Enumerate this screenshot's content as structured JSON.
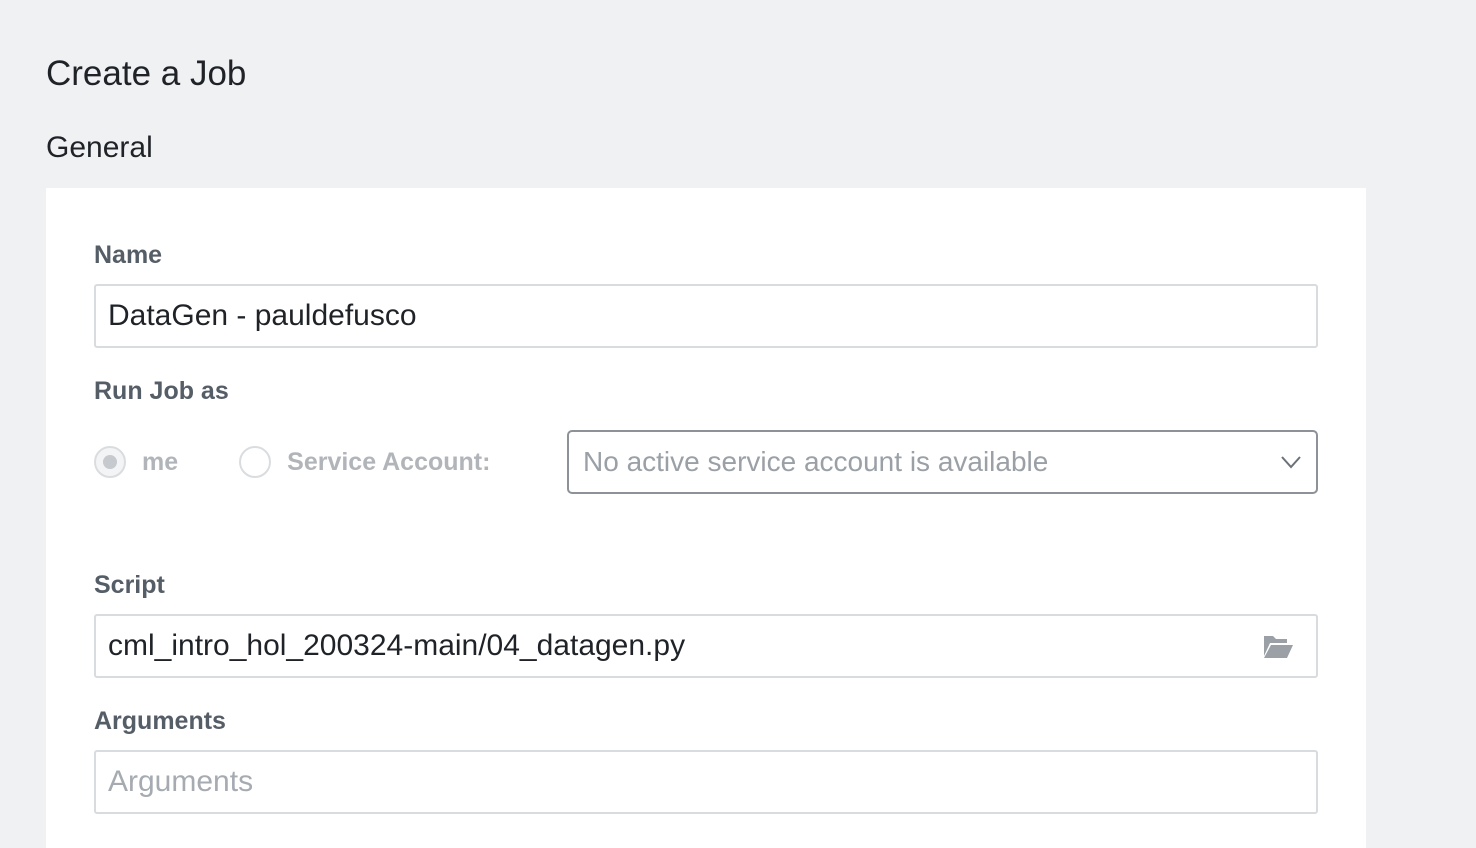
{
  "page": {
    "title": "Create a Job",
    "section_title": "General"
  },
  "form": {
    "name": {
      "label": "Name",
      "value": "DataGen - pauldefusco"
    },
    "run_as": {
      "label": "Run Job as",
      "options": [
        {
          "label": "me",
          "checked": true,
          "disabled": true
        },
        {
          "label": "Service Account:",
          "checked": false,
          "disabled": true
        }
      ],
      "service_account_select": {
        "value": "No active service account is available"
      }
    },
    "script": {
      "label": "Script",
      "value": "cml_intro_hol_200324-main/04_datagen.py"
    },
    "arguments": {
      "label": "Arguments",
      "value": "",
      "placeholder": "Arguments"
    }
  },
  "colors": {
    "background": "#f0f1f3",
    "card": "#ffffff",
    "label": "#555d66",
    "disabled_text": "#b1b5ba",
    "input_border": "#d9dcdf",
    "select_border": "#8c9298"
  },
  "icons": {
    "chevron": "chevron-down-icon",
    "folder": "folder-open-icon"
  }
}
